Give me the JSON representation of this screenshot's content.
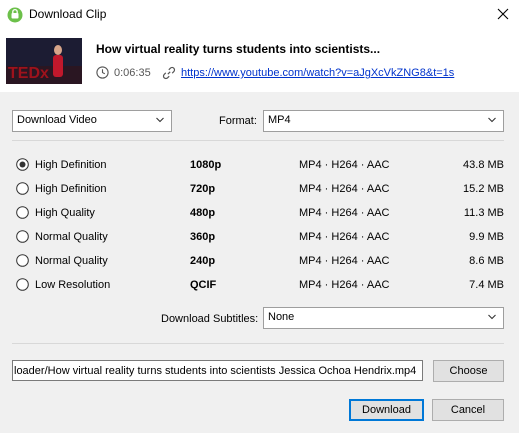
{
  "window": {
    "title": "Download Clip",
    "close_icon": "close-icon"
  },
  "clip": {
    "title": "How virtual reality turns students into scientists...",
    "duration": "0:06:35",
    "url": "https://www.youtube.com/watch?v=aJgXcVkZNG8&t=1s"
  },
  "controls": {
    "action_value": "Download Video",
    "format_label": "Format:",
    "format_value": "MP4",
    "subtitles_label": "Download Subtitles:",
    "subtitles_value": "None"
  },
  "qualities": [
    {
      "label": "High Definition",
      "resolution": "1080p",
      "codec": "MP4 · H264 · AAC",
      "size": "43.8 MB",
      "selected": true
    },
    {
      "label": "High Definition",
      "resolution": "720p",
      "codec": "MP4 · H264 · AAC",
      "size": "15.2 MB",
      "selected": false
    },
    {
      "label": "High Quality",
      "resolution": "480p",
      "codec": "MP4 · H264 · AAC",
      "size": "11.3 MB",
      "selected": false
    },
    {
      "label": "Normal Quality",
      "resolution": "360p",
      "codec": "MP4 · H264 · AAC",
      "size": "9.9 MB",
      "selected": false
    },
    {
      "label": "Normal Quality",
      "resolution": "240p",
      "codec": "MP4 · H264 · AAC",
      "size": "8.6 MB",
      "selected": false
    },
    {
      "label": "Low Resolution",
      "resolution": "QCIF",
      "codec": "MP4 · H264 · AAC",
      "size": "7.4 MB",
      "selected": false
    }
  ],
  "output": {
    "path": "loader/How virtual reality turns students into scientists   Jessica Ochoa Hendrix.mp4",
    "choose_label": "Choose"
  },
  "buttons": {
    "download_label": "Download",
    "cancel_label": "Cancel"
  },
  "colors": {
    "accent": "#0078d7",
    "link": "#0033cc",
    "app_icon": "#6cc04a"
  }
}
